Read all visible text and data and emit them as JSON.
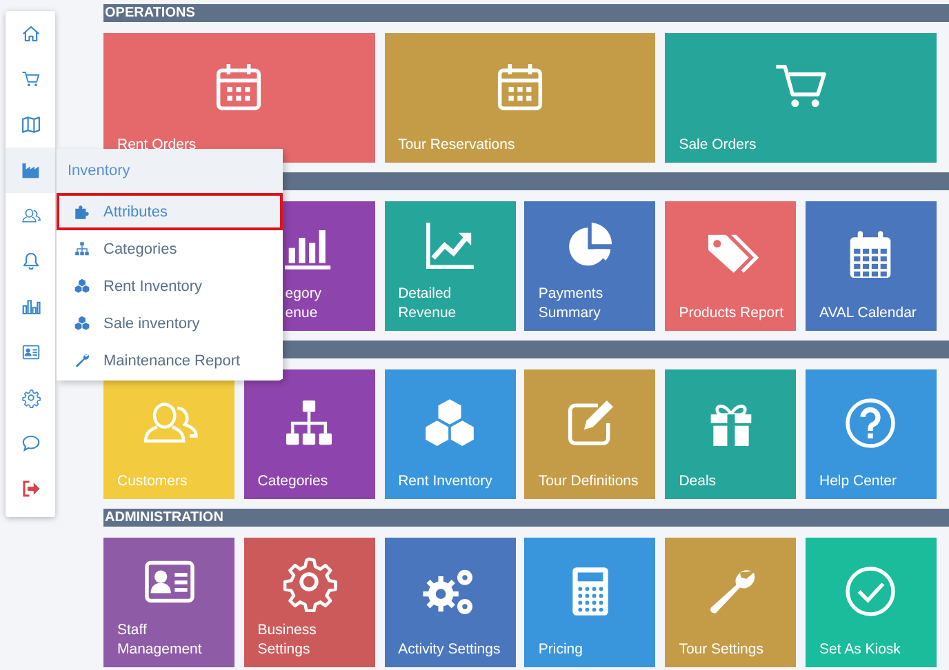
{
  "sidebar": {
    "items": [
      {
        "selected": false
      },
      {
        "selected": false
      },
      {
        "selected": false
      },
      {
        "selected": true
      },
      {
        "selected": false
      },
      {
        "selected": false
      },
      {
        "selected": false
      },
      {
        "selected": false
      },
      {
        "selected": false
      },
      {
        "selected": false
      },
      {
        "selected": false
      }
    ]
  },
  "flyout": {
    "title": "Inventory",
    "items": [
      {
        "label": "Attributes",
        "selected": true
      },
      {
        "label": "Categories",
        "selected": false
      },
      {
        "label": "Rent Inventory",
        "selected": false
      },
      {
        "label": "Sale inventory",
        "selected": false
      },
      {
        "label": "Maintenance Report",
        "selected": false
      }
    ]
  },
  "sections": [
    {
      "title": "OPERATIONS",
      "wide": true,
      "tiles": [
        {
          "label": [
            "Rent Orders"
          ],
          "color": "#e5686a"
        },
        {
          "label": [
            "Tour Reservations"
          ],
          "color": "#c49c47"
        },
        {
          "label": [
            "Sale Orders"
          ],
          "color": "#26a69a"
        }
      ]
    },
    {
      "leading_gap": true,
      "tiles": [
        {
          "label": [
            "egory",
            "enue"
          ],
          "color": "#8e44ad",
          "partly_covered": true
        },
        {
          "label": [
            "Detailed",
            "Revenue"
          ],
          "color": "#26a69a"
        },
        {
          "label": [
            "Payments",
            "Summary"
          ],
          "color": "#4a76be"
        },
        {
          "label": [
            "Products Report"
          ],
          "color": "#e5686a"
        },
        {
          "label": [
            "AVAL Calendar"
          ],
          "color": "#4a76be"
        }
      ]
    },
    {
      "tiles": [
        {
          "label": [
            "Customers"
          ],
          "color": "#f2cb3e"
        },
        {
          "label": [
            "Categories"
          ],
          "color": "#8e44ad"
        },
        {
          "label": [
            "Rent Inventory"
          ],
          "color": "#3a96dc"
        },
        {
          "label": [
            "Tour Definitions"
          ],
          "color": "#c49c47"
        },
        {
          "label": [
            "Deals"
          ],
          "color": "#26a69a"
        },
        {
          "label": [
            "Help Center"
          ],
          "color": "#3a96dc"
        }
      ]
    },
    {
      "title": "ADMINISTRATION",
      "tiles": [
        {
          "label": [
            "Staff",
            "Management"
          ],
          "color": "#8e5ba6"
        },
        {
          "label": [
            "Business",
            "Settings"
          ],
          "color": "#cd5a5a"
        },
        {
          "label": [
            "Activity Settings"
          ],
          "color": "#4a76be"
        },
        {
          "label": [
            "Pricing"
          ],
          "color": "#3a96dc"
        },
        {
          "label": [
            "Tour Settings"
          ],
          "color": "#c49c47"
        },
        {
          "label": [
            "Set As Kiosk"
          ],
          "color": "#1abc9c"
        }
      ]
    }
  ]
}
